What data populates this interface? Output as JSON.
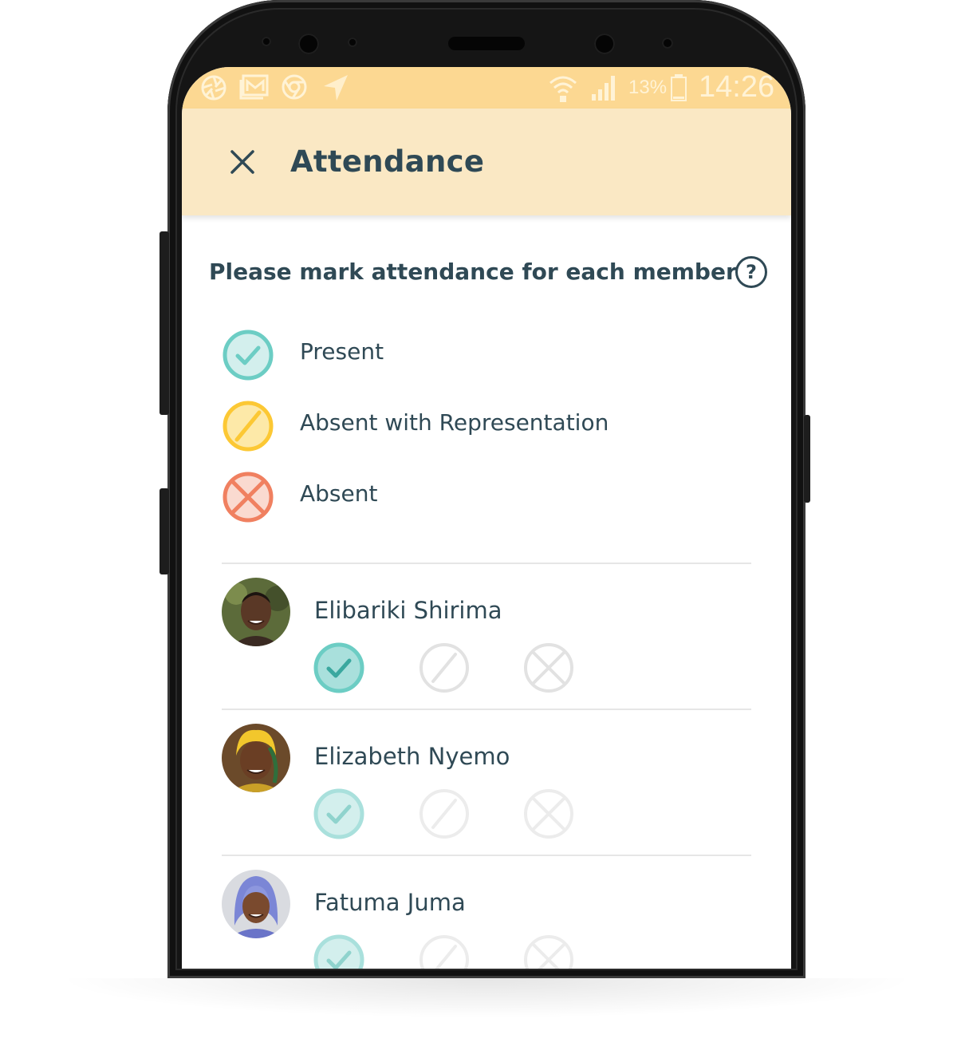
{
  "status_bar": {
    "battery": "13%",
    "time": "14:26",
    "left_icons": [
      "aperture-icon",
      "gallery-icon",
      "chrome-icon",
      "navigation-icon"
    ],
    "right_icons": [
      "wifi-icon",
      "signal-icon",
      "battery-icon"
    ]
  },
  "app_bar": {
    "title": "Attendance",
    "close_icon": "close-icon",
    "background": "#fae8c4"
  },
  "instruction": {
    "text": "Please mark attendance for each member",
    "help_label": "?"
  },
  "legend": [
    {
      "key": "present",
      "label": "Present",
      "icon": "check-circle-icon",
      "color": "#6ccdc4"
    },
    {
      "key": "represented",
      "label": "Absent with Representation",
      "icon": "slash-circle-icon",
      "color": "#fcc834"
    },
    {
      "key": "absent",
      "label": "Absent",
      "icon": "x-circle-icon",
      "color": "#f08060"
    }
  ],
  "members": [
    {
      "name": "Elibariki Shirima",
      "selected": "present"
    },
    {
      "name": "Elizabeth Nyemo",
      "selected": "present"
    },
    {
      "name": "Fatuma Juma",
      "selected": "present"
    }
  ],
  "colors": {
    "text": "#2f4955",
    "status_bar": "#fcd892",
    "inactive_icon": "#e2e2e2"
  }
}
